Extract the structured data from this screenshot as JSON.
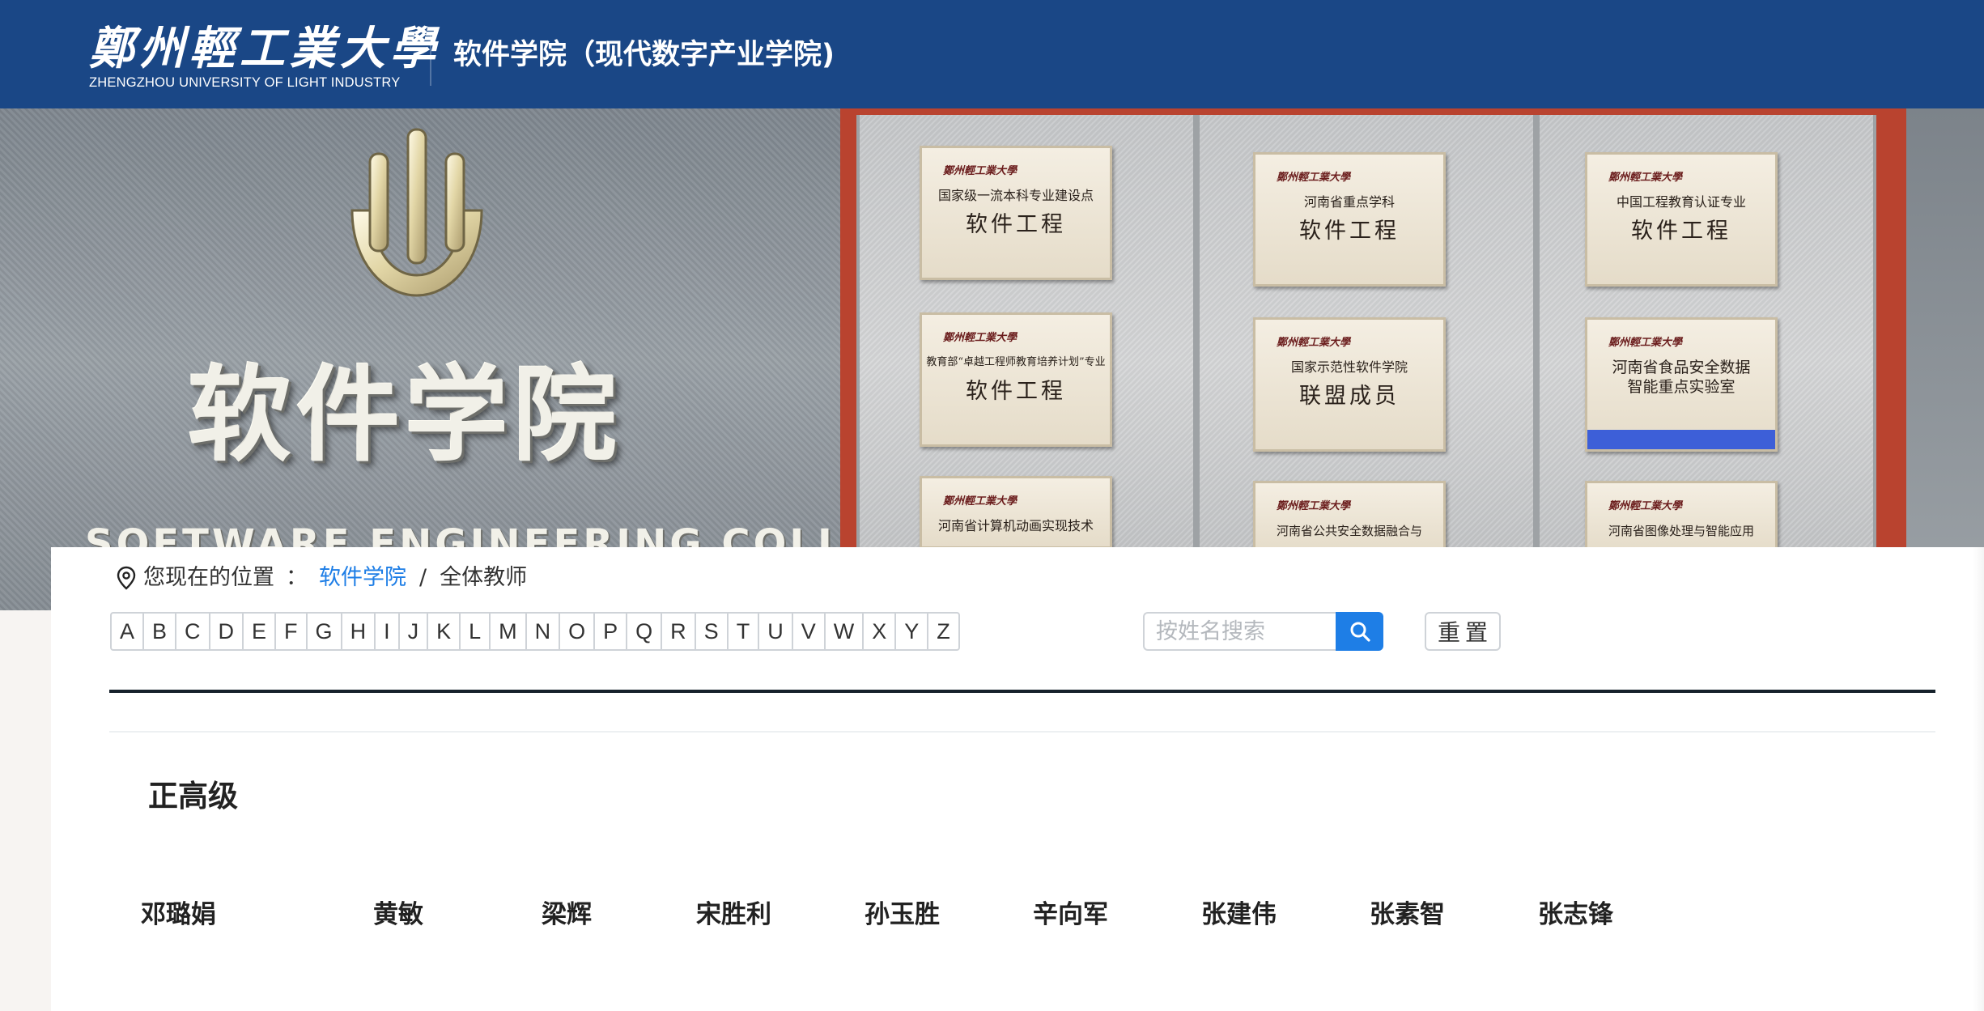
{
  "header": {
    "logo_cn": "鄭州輕工業大學",
    "logo_en": "ZHENGZHOU UNIVERSITY OF LIGHT INDUSTRY",
    "site_title": "软件学院（现代数字产业学院)",
    "bg_color": "#1a4786"
  },
  "banner": {
    "sign_cn": "软件学院",
    "sign_en": "SOFTWARE ENGINEERING COLLEGE",
    "plaques": [
      {
        "school": "鄭州輕工業大學",
        "line1": "国家级一流本科专业建设点",
        "line2": "软件工程"
      },
      {
        "school": "鄭州輕工業大學",
        "line1": "教育部“卓越工程师教育培养计划”专业",
        "line2": "软件工程"
      },
      {
        "school": "鄭州輕工業大學",
        "line1": "河南省计算机动画实现技术",
        "line2": ""
      },
      {
        "school": "鄭州輕工業大學",
        "line1": "河南省重点学科",
        "line2": "软件工程"
      },
      {
        "school": "鄭州輕工業大學",
        "line1": "国家示范性软件学院",
        "line2": "联盟成员"
      },
      {
        "school": "鄭州輕工業大學",
        "line1": "河南省公共安全数据融合与",
        "line2": ""
      },
      {
        "school": "鄭州輕工業大學",
        "line1": "中国工程教育认证专业",
        "line2": "软件工程"
      },
      {
        "school": "鄭州輕工業大學",
        "line1": "河南省食品安全数据",
        "line2": "智能重点实验室"
      },
      {
        "school": "鄭州輕工業大學",
        "line1": "河南省图像处理与智能应用",
        "line2": ""
      }
    ]
  },
  "breadcrumb": {
    "prefix": "您现在的位置",
    "colon": "：",
    "link": "软件学院",
    "separator": "/",
    "current": "全体教师",
    "icon": "location-pin-icon"
  },
  "letters": [
    "A",
    "B",
    "C",
    "D",
    "E",
    "F",
    "G",
    "H",
    "I",
    "J",
    "K",
    "L",
    "M",
    "N",
    "O",
    "P",
    "Q",
    "R",
    "S",
    "T",
    "U",
    "V",
    "W",
    "X",
    "Y",
    "Z"
  ],
  "search": {
    "placeholder": "按姓名搜索",
    "value": "",
    "button_icon": "search-icon",
    "reset_label": "重置",
    "accent": "#1e7ee6"
  },
  "section": {
    "title": "正高级",
    "teachers": [
      "邓璐娟",
      "黄敏",
      "梁辉",
      "宋胜利",
      "孙玉胜",
      "辛向军",
      "张建伟",
      "张素智",
      "张志锋"
    ]
  }
}
